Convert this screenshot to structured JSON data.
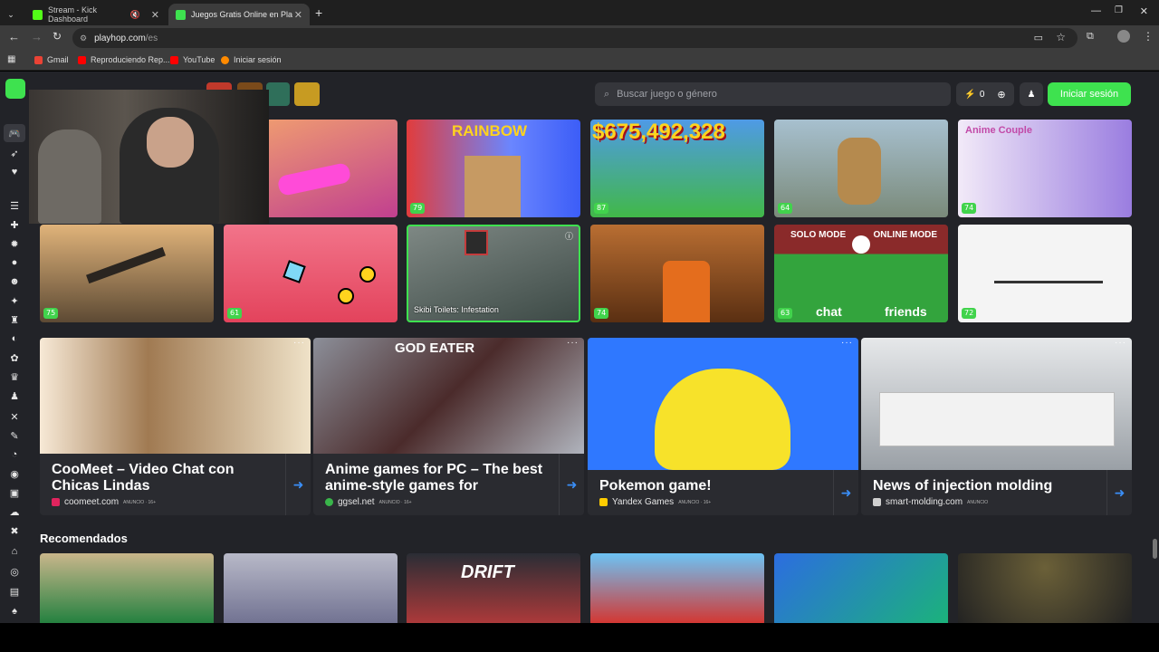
{
  "browser": {
    "tabs": [
      {
        "label": "Stream - Kick Dashboard",
        "active": false,
        "color": "#53fc18"
      },
      {
        "label": "Juegos Gratis Online en Playhop",
        "active": true,
        "color": "#3ee24f"
      }
    ],
    "url_host": "playhop.com",
    "url_path": "/es",
    "bookmarks": [
      {
        "label": "Gmail",
        "color": "#ea4335"
      },
      {
        "label": "Reproduciendo Rep...",
        "color": "#ff0000"
      },
      {
        "label": "YouTube",
        "color": "#ff0000"
      },
      {
        "label": "Iniciar sesión",
        "color": "#ff8a00"
      }
    ]
  },
  "header": {
    "search_placeholder": "Buscar juego o género",
    "coins": "0",
    "login_label": "Iniciar sesión"
  },
  "games_row1": [
    {
      "rating": "",
      "icon": "racing-car",
      "c1": "#f09f6f",
      "c2": "#c13f8f"
    },
    {
      "rating": "79",
      "title_art": "RAINBOW",
      "icon": "rainbow-friends",
      "c1": "#3c5df7",
      "c2": "#e13c3c"
    },
    {
      "rating": "87",
      "title_art": "$675,492,328",
      "icon": "money-game",
      "c1": "#3a83d9",
      "c2": "#41b848"
    },
    {
      "rating": "64",
      "icon": "cat-cowboy",
      "c1": "#91a7b8",
      "c2": "#a0875b"
    },
    {
      "rating": "74",
      "title_art": "Anime Couple",
      "icon": "anime-couple",
      "c1": "#e7dff5",
      "c2": "#8f6bdc"
    }
  ],
  "games_row2": [
    {
      "rating": "75",
      "icon": "artillery",
      "c1": "#c79a60",
      "c2": "#5d4a34"
    },
    {
      "rating": "61",
      "icon": "geometry",
      "c1": "#f2748a",
      "c2": "#e3435c"
    },
    {
      "rating": "",
      "title": "Skibi Toilets: Infestation",
      "icon": "skibidi",
      "c1": "#6f7a76",
      "c2": "#3d4a46"
    },
    {
      "rating": "74",
      "icon": "prisoner-shovel",
      "c1": "#9b5522",
      "c2": "#d9741f"
    },
    {
      "rating": "63",
      "title_art": "SOLO MODE",
      "title_art2": "ONLINE MODE",
      "sub1": "chat",
      "sub2": "friends",
      "icon": "soccer",
      "c1": "#33a43d",
      "c2": "#c23d3d"
    },
    {
      "rating": "72",
      "icon": "sketch",
      "c1": "#f6f6f6",
      "c2": "#dcdcdc"
    }
  ],
  "ads": [
    {
      "headline": "CooMeet – Video Chat con Chicas Lindas",
      "line1": "CooMeet – Video Chat con",
      "line2": "Chicas Lindas",
      "source": "coomeet.com",
      "meta": "ANUNCIO · 16+",
      "c1": "#d9c7a9",
      "c2": "#8f6b45",
      "fav": "#e0245e"
    },
    {
      "headline": "Anime games for PC – The best anime-style games for",
      "line1": "Anime games for PC – The best",
      "line2": "anime-style games for",
      "source": "ggsel.net",
      "meta": "ANUNCIO · 16+",
      "art": "GOD EATER",
      "c1": "#5a5c66",
      "c2": "#8b2a2a",
      "fav": "#39b54a"
    },
    {
      "headline": "Pokemon game!",
      "line1": "Pokemon game!",
      "line2": "",
      "source": "Yandex Games",
      "meta": "ANUNCIO · 16+",
      "c1": "#2f78ff",
      "c2": "#f7e22a",
      "fav": "#ffcc00"
    },
    {
      "headline": "News of injection molding",
      "line1": "News of injection molding",
      "line2": "",
      "source": "smart-molding.com",
      "meta": "ANUNCIO",
      "c1": "#d7d9dc",
      "c2": "#9aa0a6",
      "fav": "#cfcfcf"
    }
  ],
  "recommended": {
    "title": "Recomendados",
    "items": [
      {
        "icon": "poker",
        "c1": "#1e7f3d",
        "c2": "#c9b68b"
      },
      {
        "icon": "skibidi-fight",
        "c1": "#a8a9b8",
        "c2": "#6f7090"
      },
      {
        "icon": "drift",
        "title_art": "DRIFT",
        "c1": "#2a2d35",
        "c2": "#b13a3a"
      },
      {
        "icon": "bank-brothers",
        "c1": "#6cc3f5",
        "c2": "#d7322b"
      },
      {
        "icon": "hero",
        "c1": "#2c6de0",
        "c2": "#1bb37a"
      },
      {
        "icon": "dark-room",
        "c1": "#222222",
        "c2": "#4a4232"
      }
    ]
  }
}
